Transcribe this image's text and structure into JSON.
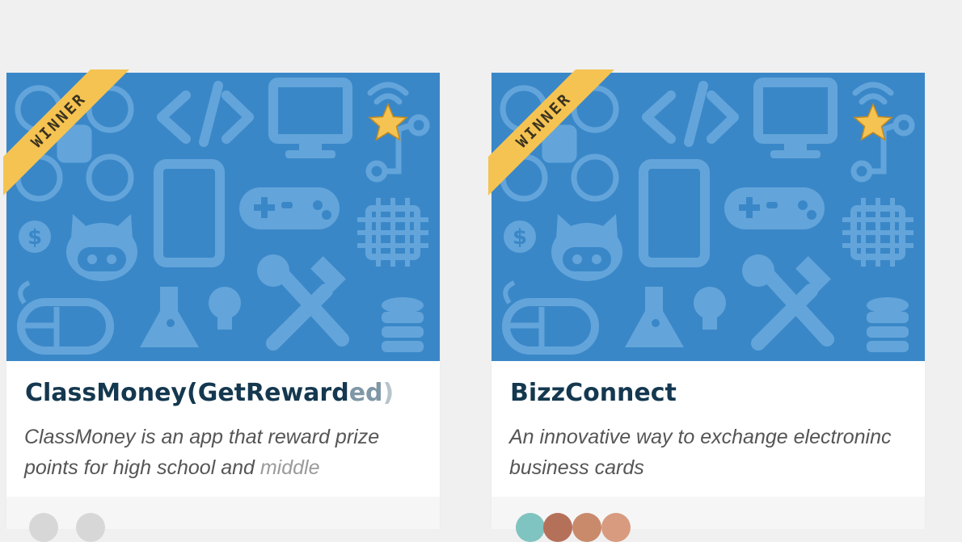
{
  "cards": [
    {
      "badge": "WINNER",
      "title_main": "ClassMoney(GetReward",
      "title_fade": "ed",
      "title_fade2": ")",
      "desc_main": "ClassMoney is an app that reward prize points for high school and ",
      "desc_fade": "middle",
      "starred": true
    },
    {
      "badge": "WINNER",
      "title_main": "BizzConnect",
      "title_fade": "",
      "title_fade2": "",
      "desc_main": "An innovative way to exchange electroninc business cards",
      "desc_fade": "",
      "starred": true
    }
  ],
  "colors": {
    "thumbnail_bg": "#3a87c8",
    "ribbon": "#f5c352",
    "star": "#f5c352",
    "title": "#14384f",
    "page_bg": "#f0f0f0"
  },
  "icons": [
    "drone-icon",
    "code-icon",
    "monitor-icon",
    "wifi-icon",
    "phone-icon",
    "gamepad-icon",
    "dollar-icon",
    "github-icon",
    "chip-icon",
    "mouse-icon",
    "flask-icon",
    "bulb-icon",
    "tools-icon",
    "database-icon",
    "circuit-icon",
    "star-icon"
  ]
}
